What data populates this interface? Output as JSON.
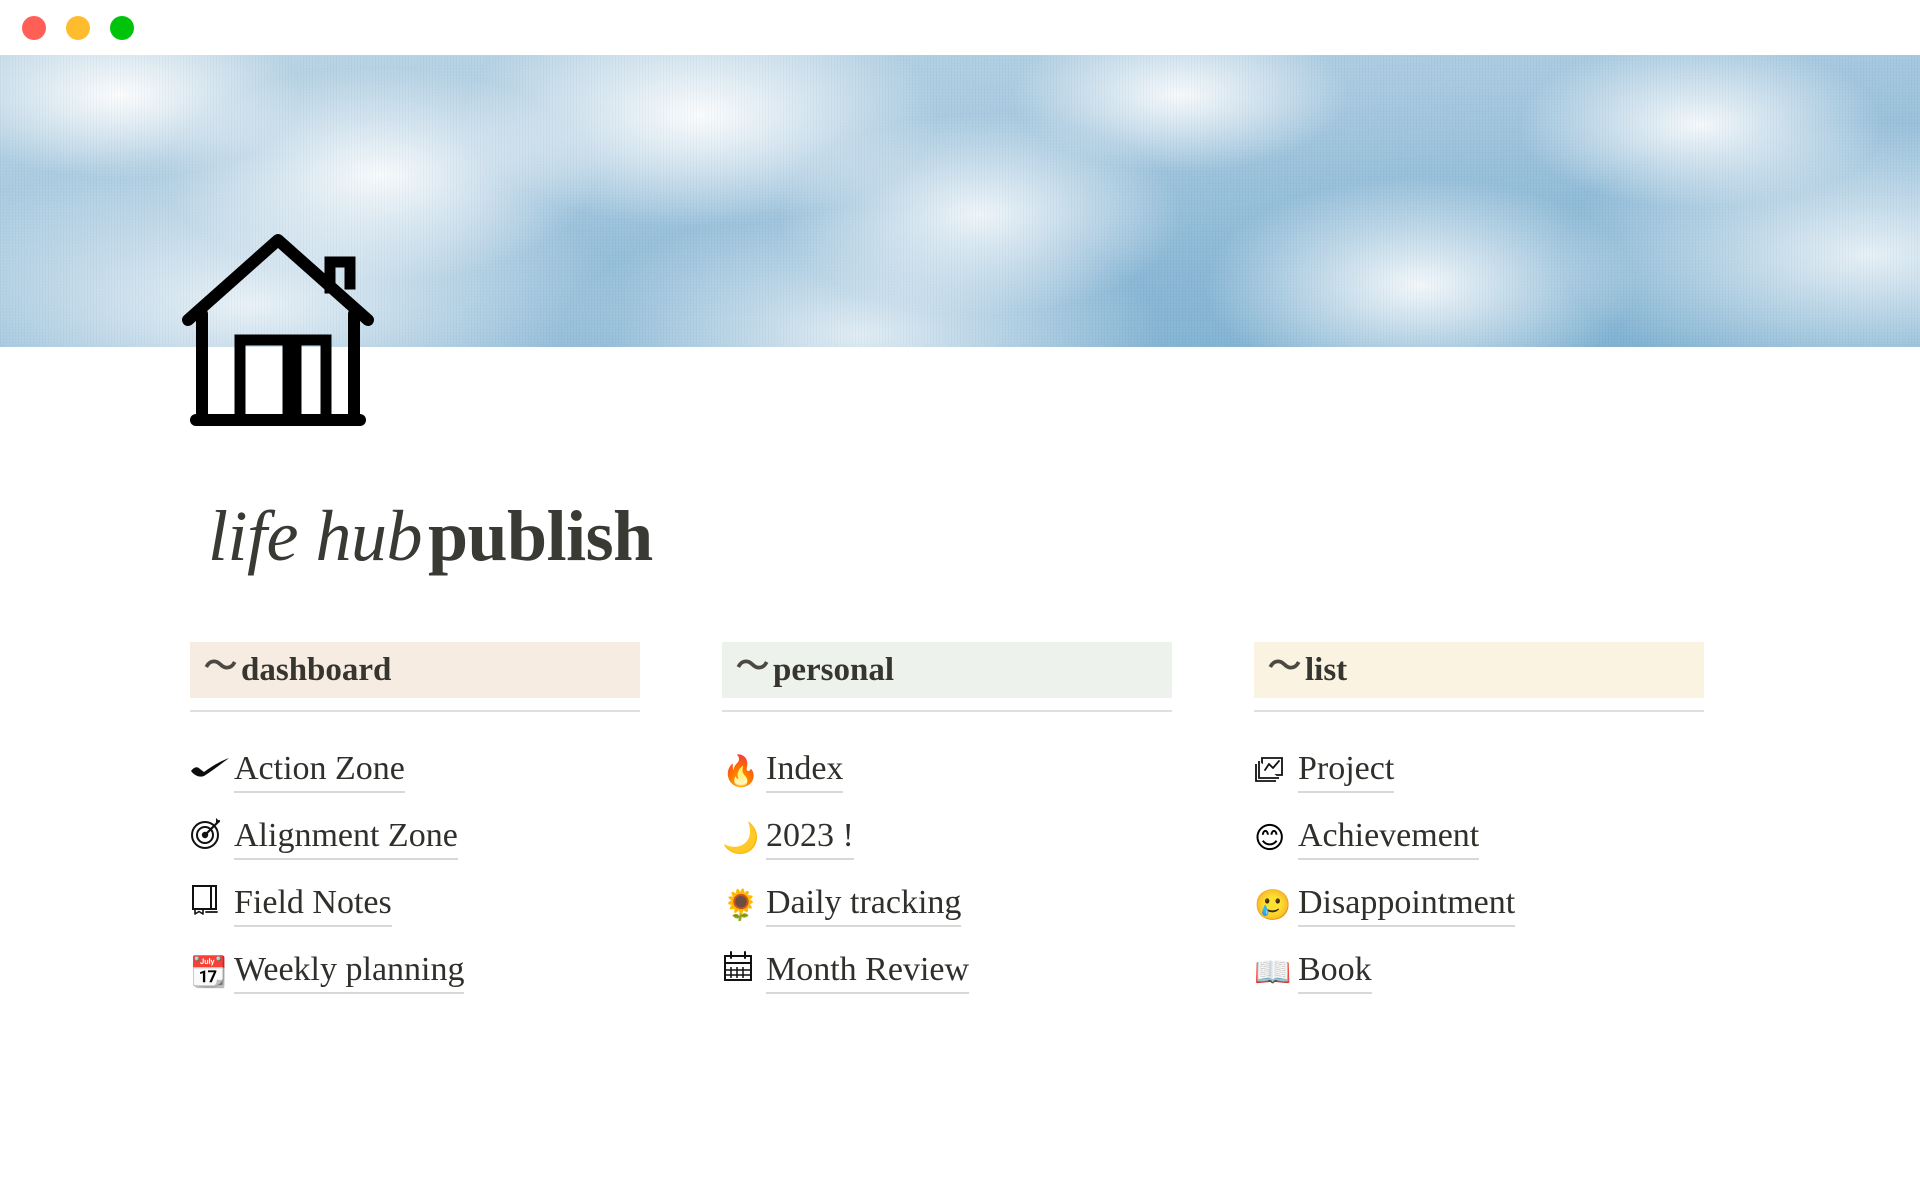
{
  "window": {
    "controls": [
      {
        "name": "close",
        "color": "#ff5f57"
      },
      {
        "name": "minimize",
        "color": "#ffbd2e"
      },
      {
        "name": "zoom",
        "color": "#00c40b"
      }
    ]
  },
  "cover": {
    "image_description": "blue sky with white clouds",
    "sky_color": "#8ab8d6",
    "cloud_color": "#ffffff"
  },
  "page": {
    "icon": "house-icon",
    "title_italic": "life hub",
    "title_bold": "publish"
  },
  "columns": [
    {
      "key": "dashboard",
      "heading": "dashboard",
      "squiggle": "〜",
      "bg": "#f7ece1",
      "items": [
        {
          "icon": "swoosh-check-icon",
          "emoji": "",
          "label": "Action Zone"
        },
        {
          "icon": "dart-target-icon",
          "emoji": "",
          "label": "Alignment Zone"
        },
        {
          "icon": "notebook-icon",
          "emoji": "",
          "label": "Field Notes"
        },
        {
          "icon": "spiral-calendar-icon",
          "emoji": "📆",
          "label": "Weekly planning"
        }
      ]
    },
    {
      "key": "personal",
      "heading": "personal",
      "squiggle": "〜",
      "bg": "#edf2ed",
      "items": [
        {
          "icon": "flame-icon",
          "emoji": "🔥",
          "label": "Index"
        },
        {
          "icon": "crescent-moon-icon",
          "emoji": "🌙",
          "label": "2023 !"
        },
        {
          "icon": "sunflower-icon",
          "emoji": "🌻",
          "label": "Daily tracking"
        },
        {
          "icon": "calendar-icon",
          "emoji": "",
          "label": "Month Review"
        }
      ]
    },
    {
      "key": "list",
      "heading": "list",
      "squiggle": "〜",
      "bg": "#faf3e1",
      "items": [
        {
          "icon": "chart-pages-icon",
          "emoji": "",
          "label": "Project"
        },
        {
          "icon": "smiling-face-icon",
          "emoji": "😊",
          "label": "Achievement"
        },
        {
          "icon": "crying-face-icon",
          "emoji": "🥲",
          "label": "Disappointment"
        },
        {
          "icon": "open-book-arrow-icon",
          "emoji": "📖",
          "label": "Book"
        }
      ]
    }
  ]
}
